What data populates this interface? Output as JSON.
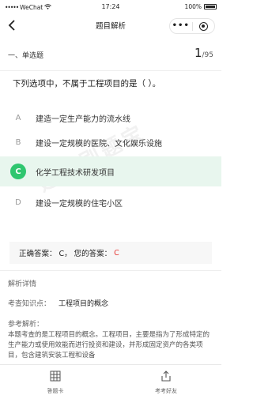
{
  "status": {
    "carrier": "WeChat",
    "time": "17:24",
    "battery": "100%"
  },
  "nav": {
    "title": "题目解析",
    "more_glyph": "•••"
  },
  "question_header": {
    "type": "一、单选题",
    "current": "1",
    "total": "/95"
  },
  "question": {
    "text": "下列选项中，不属于工程项目的是（   ）。"
  },
  "options": [
    {
      "letter": "A",
      "text": "建造一定生产能力的流水线"
    },
    {
      "letter": "B",
      "text": "建设一定规模的医院、文化娱乐设施"
    },
    {
      "letter": "C",
      "text": "化学工程技术研发项目"
    },
    {
      "letter": "D",
      "text": "建设一定规模的住宅小区"
    }
  ],
  "answer": {
    "correct_label": "正确答案：",
    "correct_value": "C，",
    "user_label": "您的答案：",
    "user_value": "C"
  },
  "analysis": {
    "title": "解析详情",
    "knowledge_label": "考查知识点：",
    "knowledge_value": "工程项目的概念",
    "reference_label": "参考解析：",
    "reference_text": "本题考查的是工程项目的概念。工程项目，主要是指为了形成特定的生产能力或使用效能而进行投资和建设，并形成固定资产的各类项目，包含建筑安装工程和设备"
  },
  "watermark": "建筑刷题宝",
  "bottom_bar": {
    "answer_sheet": "答题卡",
    "share": "考考好友"
  },
  "colors": {
    "correct_bg": "#e8f6ee",
    "correct_badge": "#2fc66f",
    "user_answer": "#e53935"
  }
}
